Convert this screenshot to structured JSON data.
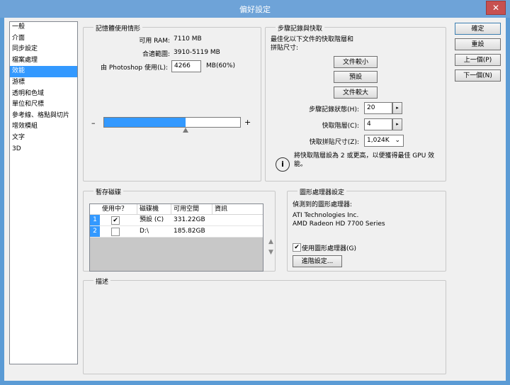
{
  "window": {
    "title": "偏好設定",
    "close_glyph": "✕"
  },
  "categories": [
    "一般",
    "介面",
    "同步設定",
    "檔案處理",
    "效能",
    "游標",
    "透明和色域",
    "單位和尺標",
    "參考線、格點與切片",
    "增效模組",
    "文字",
    "3D"
  ],
  "selected_category_index": 4,
  "memory": {
    "title": "記憶體使用情形",
    "available_label": "可用 RAM:",
    "available_value": "7110 MB",
    "range_label": "合適範圍:",
    "range_value": "3910-5119 MB",
    "use_label": "由 Photoshop 使用(L):",
    "use_value": "4266",
    "use_unit": "MB(60%)",
    "slider_fraction": 0.6,
    "minus": "–",
    "plus": "+"
  },
  "history": {
    "title": "步驟記錄與快取",
    "desc": "最佳化以下文件的快取階層和\n拼貼尺寸:",
    "btn_small": "文件較小",
    "btn_default": "預設",
    "btn_large": "文件較大",
    "states_label": "步驟記錄狀態(H):",
    "states_value": "20",
    "levels_label": "快取階層(C):",
    "levels_value": "4",
    "tile_label": "快取拼貼尺寸(Z):",
    "tile_value": "1,024K",
    "note": "將快取階層設為 2 或更高，以便獲得最佳 GPU 效能。",
    "info_glyph": "i",
    "spin_glyph": "▸",
    "dropdown_glyph": "⌄"
  },
  "scratch": {
    "title": "暫存磁碟",
    "headers": [
      "使用中？",
      "磁碟機",
      "可用空間",
      "資訊"
    ],
    "rows": [
      {
        "num": "1",
        "active": true,
        "drive": "預設 (C)",
        "free": "331.22GB",
        "info": ""
      },
      {
        "num": "2",
        "active": false,
        "drive": "D:\\",
        "free": "185.82GB",
        "info": ""
      }
    ],
    "check_glyph": "✔",
    "up_glyph": "▲",
    "down_glyph": "▼"
  },
  "gpu": {
    "title": "圖形處理器設定",
    "detected_label": "偵測到的圖形處理器:",
    "vendor": "ATI Technologies Inc.",
    "model": "AMD Radeon HD 7700 Series",
    "use_gpu_label": "使用圖形處理器(G)",
    "use_gpu_checked": true,
    "advanced_btn": "進階設定...",
    "check_glyph": "✔"
  },
  "description": {
    "title": "描述"
  },
  "buttons": {
    "ok": "確定",
    "reset": "重設",
    "prev": "上一個(P)",
    "next": "下一個(N)"
  }
}
